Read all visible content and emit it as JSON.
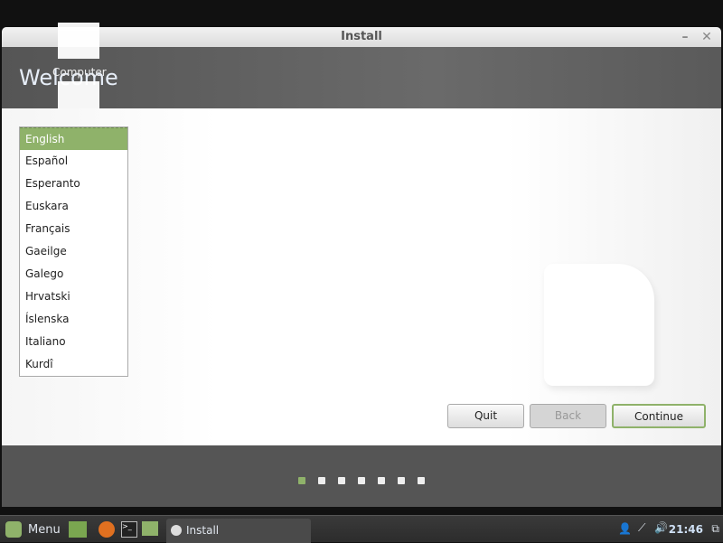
{
  "window": {
    "title": "Install",
    "minimize_icon": "minimize-icon",
    "close_icon": "close-icon"
  },
  "header": {
    "title": "Welcome"
  },
  "desktop": {
    "computer_label": "Computer"
  },
  "languages": [
    "English",
    "Español",
    "Esperanto",
    "Euskara",
    "Français",
    "Gaeilge",
    "Galego",
    "Hrvatski",
    "Íslenska",
    "Italiano",
    "Kurdî"
  ],
  "selected_language": "English",
  "buttons": {
    "quit": "Quit",
    "back": "Back",
    "continue": "Continue"
  },
  "progress": {
    "current_step": 1,
    "total_steps": 7
  },
  "taskbar": {
    "menu": "Menu",
    "task": "Install",
    "clock": "21:46"
  },
  "colors": {
    "accent": "#8fb26a"
  }
}
